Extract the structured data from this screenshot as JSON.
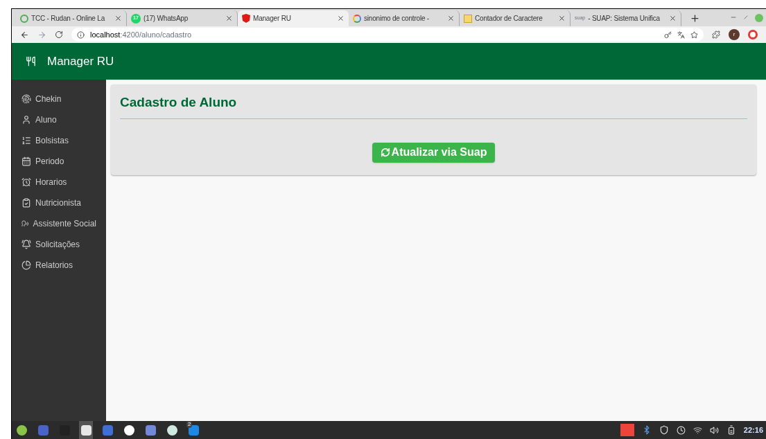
{
  "browser": {
    "tabs": [
      {
        "title": "TCC - Rudan - Online La",
        "selected": false
      },
      {
        "title": "(17) WhatsApp",
        "selected": false,
        "favicon_text": "17"
      },
      {
        "title": "Manager RU",
        "selected": true
      },
      {
        "title": "sinonimo de controle -",
        "selected": false
      },
      {
        "title": "Contador de Caractere",
        "selected": false
      },
      {
        "title": "- SUAP: Sistema Unifica",
        "selected": false,
        "favicon_text": "suap"
      }
    ],
    "address": {
      "host": "localhost",
      "path": ":4200/aluno/cadastro"
    },
    "profile_initial": "r"
  },
  "app": {
    "title": "Manager RU"
  },
  "sidebar": {
    "items": [
      {
        "label": "Chekin"
      },
      {
        "label": "Aluno"
      },
      {
        "label": "Bolsistas"
      },
      {
        "label": "Periodo"
      },
      {
        "label": "Horarios"
      },
      {
        "label": "Nutricionista"
      },
      {
        "label": "Assistente Social"
      },
      {
        "label": "Solicitações"
      },
      {
        "label": "Relatorios"
      }
    ]
  },
  "card": {
    "title": "Cadastro de Aluno",
    "button": "Atualizar via Suap"
  },
  "taskbar": {
    "apps": [
      {
        "selected": false
      },
      {
        "selected": false
      },
      {
        "selected": false
      },
      {
        "selected": true
      },
      {
        "selected": false
      },
      {
        "selected": false
      },
      {
        "selected": false
      },
      {
        "selected": false
      },
      {
        "selected": false,
        "badge": "2"
      }
    ],
    "clock": "22:16"
  }
}
